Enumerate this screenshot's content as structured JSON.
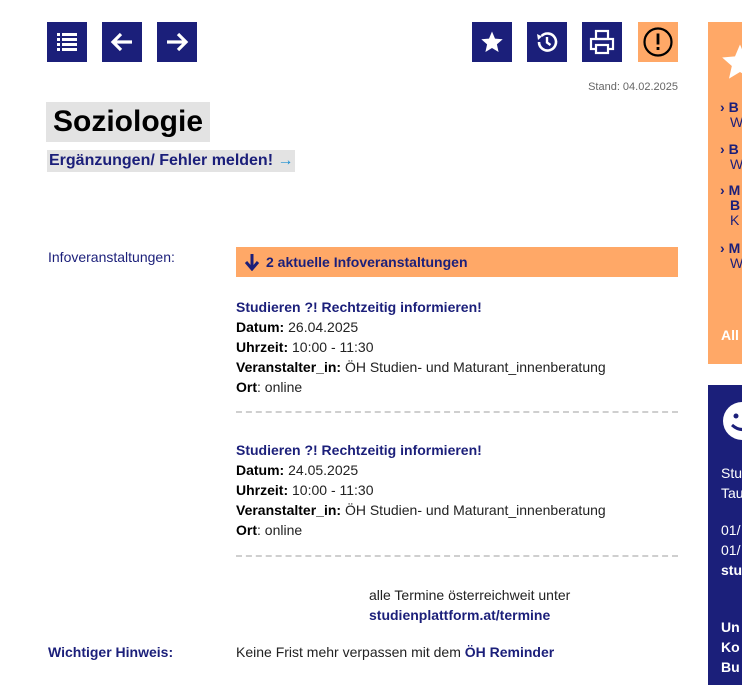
{
  "toolbar": {
    "list_icon": "list-icon",
    "back_icon": "arrow-left-icon",
    "forward_icon": "arrow-right-icon",
    "favorite_icon": "star-icon",
    "history_icon": "history-icon",
    "print_icon": "printer-icon",
    "warning_icon": "exclamation-icon"
  },
  "stand": "Stand: 04.02.2025",
  "title": "Soziologie",
  "report_link": "Ergänzungen/ Fehler melden!",
  "info": {
    "label": "Infoveranstaltungen:",
    "bar_text": "2 aktuelle Infoveranstaltungen",
    "events": [
      {
        "title": "Studieren ?! Rechtzeitig informieren!",
        "date_label": "Datum:",
        "date": "26.04.2025",
        "time_label": "Uhrzeit:",
        "time": "10:00 - 11:30",
        "org_label": "Veranstalter_in:",
        "org": "ÖH Studien- und Maturant_innenberatung",
        "place_label": "Ort",
        "place": ": online"
      },
      {
        "title": "Studieren ?! Rechtzeitig informieren!",
        "date_label": "Datum:",
        "date": "24.05.2025",
        "time_label": "Uhrzeit:",
        "time": "10:00 - 11:30",
        "org_label": "Veranstalter_in:",
        "org": "ÖH Studien- und Maturant_innenberatung",
        "place_label": "Ort",
        "place": ": online"
      }
    ],
    "all_terms_text": "alle Termine österreichweit unter",
    "all_terms_link": "studienplattform.at/termine"
  },
  "hint": {
    "label": "Wichtiger Hinweis:",
    "text": "Keine Frist mehr verpassen mit dem",
    "link": "ÖH Reminder"
  },
  "sidebar": {
    "items": [
      {
        "head": "B",
        "sub": "W"
      },
      {
        "head": "B",
        "sub": "W"
      },
      {
        "head": "M",
        "head2": "B",
        "sub": "K"
      },
      {
        "head": "M",
        "sub": "W"
      }
    ],
    "all": "All",
    "navy_lines": [
      "Stu",
      "Tau",
      "01/",
      "01/",
      "stu",
      "Un",
      "Ko",
      "Bu"
    ]
  }
}
